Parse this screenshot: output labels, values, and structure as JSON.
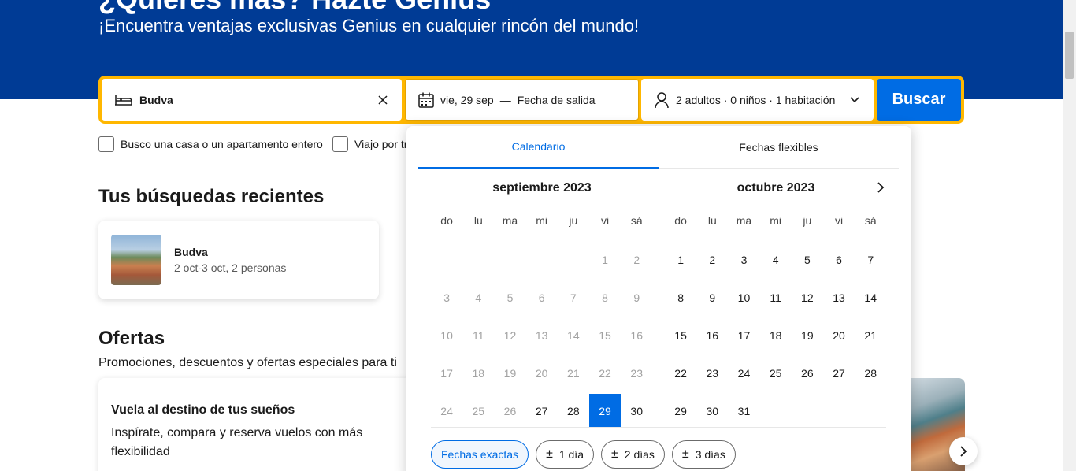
{
  "hero": {
    "title": "¿Quieres más? Hazte Genius",
    "subtitle": "¡Encuentra ventajas exclusivas Genius en cualquier rincón del mundo!"
  },
  "search": {
    "destination": "Budva",
    "checkin": "vie, 29 sep",
    "dash": "—",
    "checkout": "Fecha de salida",
    "guests": "2 adultos · 0 niños · 1 habitación",
    "button": "Buscar"
  },
  "checks": [
    "Busco una casa o un apartamento entero",
    "Viajo por trabajo"
  ],
  "recent": {
    "title": "Tus búsquedas recientes",
    "card": {
      "name": "Budva",
      "meta": "2 oct-3 oct, 2 personas"
    }
  },
  "offers": {
    "title": "Ofertas",
    "subtitle": "Promociones, descuentos y ofertas especiales para ti",
    "card": {
      "title": "Vuela al destino de tus sueños",
      "desc": "Inspírate, compara y reserva vuelos con más flexibilidad"
    }
  },
  "datepicker": {
    "tabs": {
      "calendar": "Calendario",
      "flexible": "Fechas flexibles"
    },
    "dow": [
      "do",
      "lu",
      "ma",
      "mi",
      "ju",
      "vi",
      "sá"
    ],
    "months": [
      {
        "title": "septiembre 2023",
        "lead": 5,
        "days": 30,
        "muted_until": 26,
        "selected": 29
      },
      {
        "title": "octubre 2023",
        "lead": 0,
        "days": 31,
        "muted_until": 0,
        "selected": null
      }
    ],
    "chips": [
      "Fechas exactas",
      "1 día",
      "2 días",
      "3 días"
    ],
    "chip_prefix": "±"
  },
  "colors": {
    "brand_blue": "#003b95",
    "accent_blue": "#006ce4",
    "search_yellow": "#ffb700"
  }
}
